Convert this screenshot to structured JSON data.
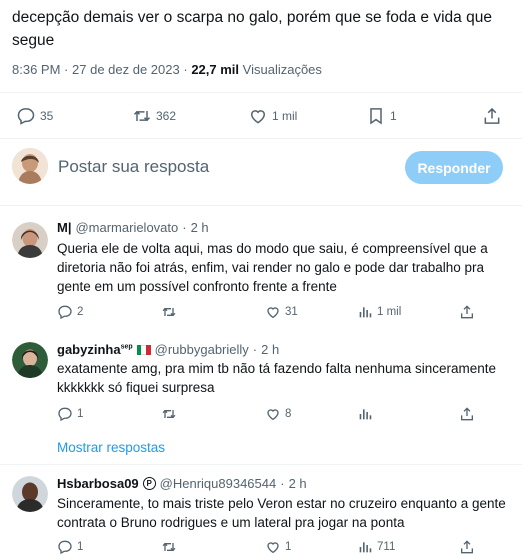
{
  "main_tweet": {
    "text": "decepção demais ver o scarpa no galo, porém que se foda e vida que segue",
    "time": "8:36 PM",
    "sep": "·",
    "date": "27 de dez de 2023",
    "views_count": "22,7 mil",
    "views_label": "Visualizações",
    "stats": {
      "replies": "35",
      "retweets": "362",
      "likes": "1 mil",
      "bookmarks": "1"
    }
  },
  "reply_box": {
    "placeholder": "Postar sua resposta",
    "button": "Responder"
  },
  "replies": [
    {
      "name": "M|",
      "handle": "@marmarielovato",
      "time": "2 h",
      "text": "Queria ele de volta aqui, mas do modo que saiu, é compreensível que a diretoria não foi atrás, enfim, vai render no galo e pode dar trabalho pra gente em um possível confronto frente a frente",
      "replies": "2",
      "retweets": "",
      "likes": "31",
      "views": "1 mil"
    },
    {
      "name": "gabyzinha",
      "name_sup": "sep",
      "handle": "@rubbygabrielly",
      "time": "2 h",
      "text": "exatamente amg, pra mim tb não tá fazendo falta nenhuma sinceramente kkkkkkk só fiquei surpresa",
      "replies": "1",
      "retweets": "",
      "likes": "8",
      "views": ""
    },
    {
      "name": "Hsbarbosa09",
      "name_badge": "P",
      "handle": "@Henriqu89346544",
      "time": "2 h",
      "text": "Sinceramente, to mais triste pelo Veron estar no cruzeiro enquanto a gente contrata o Bruno rodrigues e um lateral pra jogar na ponta",
      "replies": "1",
      "retweets": "",
      "likes": "1",
      "views": "711"
    }
  ],
  "show_replies": "Mostrar respostas",
  "colors": {
    "accent": "#1d9bf0",
    "button_disabled": "#8ecdf8",
    "secondary_text": "#536471",
    "divider": "#eff3f4"
  },
  "icons": [
    "reply-icon",
    "retweet-icon",
    "like-icon",
    "bookmark-icon",
    "share-icon",
    "views-icon"
  ]
}
